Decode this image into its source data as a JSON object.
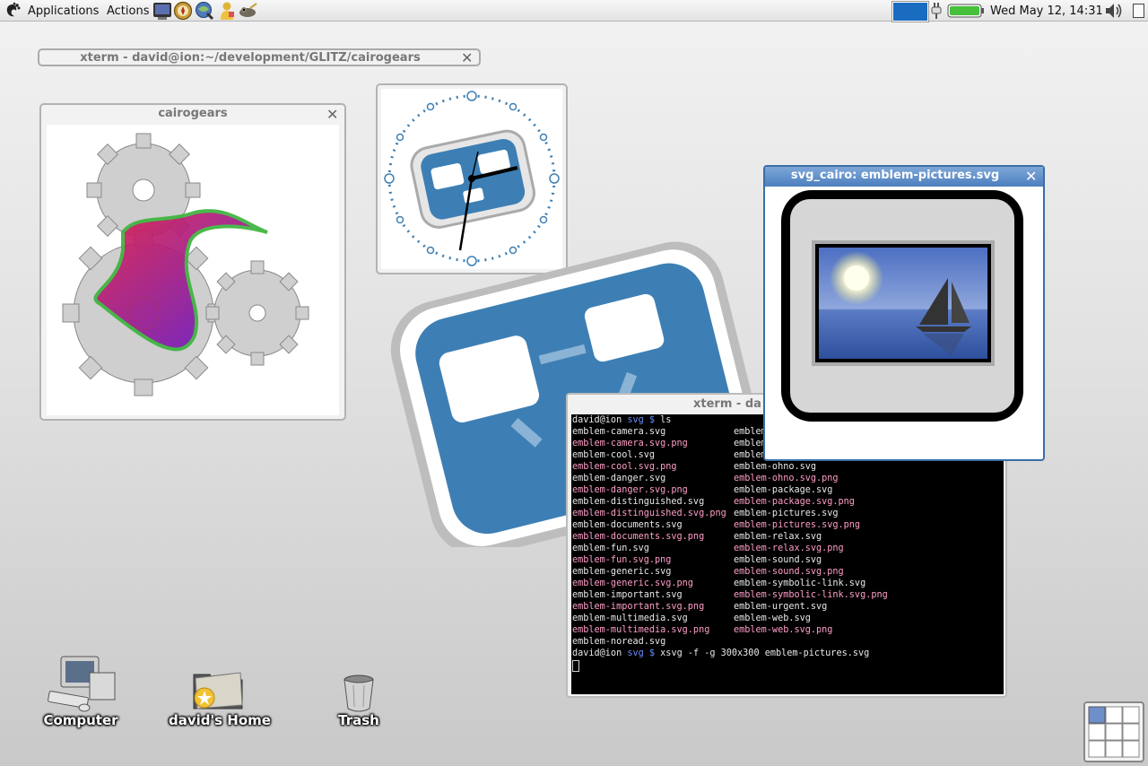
{
  "panel": {
    "menu_applications": "Applications",
    "menu_actions": "Actions",
    "launchers": [
      "terminal-icon",
      "compass-icon",
      "browser-icon",
      "user-icon",
      "gimp-icon"
    ],
    "clock": "Wed May 12, 14:31"
  },
  "windows": {
    "xterm_minimized": {
      "title": "xterm - david@ion:~/development/GLITZ/cairogears"
    },
    "cairogears": {
      "title": "cairogears"
    },
    "svg_cairo": {
      "title": "svg_cairo: emblem-pictures.svg"
    },
    "xterm_main": {
      "title": "xterm - da"
    }
  },
  "terminal": {
    "prompt_user": "david@ion",
    "prompt_dir": "svg",
    "prompt_symbol": "$",
    "command_ls": "ls",
    "col_left": [
      "emblem-camera.svg",
      "emblem-camera.svg.png",
      "emblem-cool.svg",
      "emblem-cool.svg.png",
      "emblem-danger.svg",
      "emblem-danger.svg.png",
      "emblem-distinguished.svg",
      "emblem-distinguished.svg.png",
      "emblem-documents.svg",
      "emblem-documents.svg.png",
      "emblem-fun.svg",
      "emblem-fun.svg.png",
      "emblem-generic.svg",
      "emblem-generic.svg.png",
      "emblem-important.svg",
      "emblem-important.svg.png",
      "emblem-multimedia.svg",
      "emblem-multimedia.svg.png",
      "emblem-noread.svg"
    ],
    "col_right": [
      "emblem",
      "emblem",
      "emblem",
      "emblem-ohno.svg",
      "emblem-ohno.svg.png",
      "emblem-package.svg",
      "emblem-package.svg.png",
      "emblem-pictures.svg",
      "emblem-pictures.svg.png",
      "emblem-relax.svg",
      "emblem-relax.svg.png",
      "emblem-sound.svg",
      "emblem-sound.svg.png",
      "emblem-symbolic-link.svg",
      "emblem-symbolic-link.svg.png",
      "emblem-urgent.svg",
      "emblem-web.svg",
      "emblem-web.svg.png"
    ],
    "command_xsvg": "xsvg -f -g 300x300 emblem-pictures.svg"
  },
  "desktop_icons": {
    "computer": "Computer",
    "home": "david's Home",
    "trash": "Trash"
  },
  "colors": {
    "accent": "#3d7fb4",
    "battery": "#46c03a",
    "titlebar_active": "#4c7fbe"
  }
}
